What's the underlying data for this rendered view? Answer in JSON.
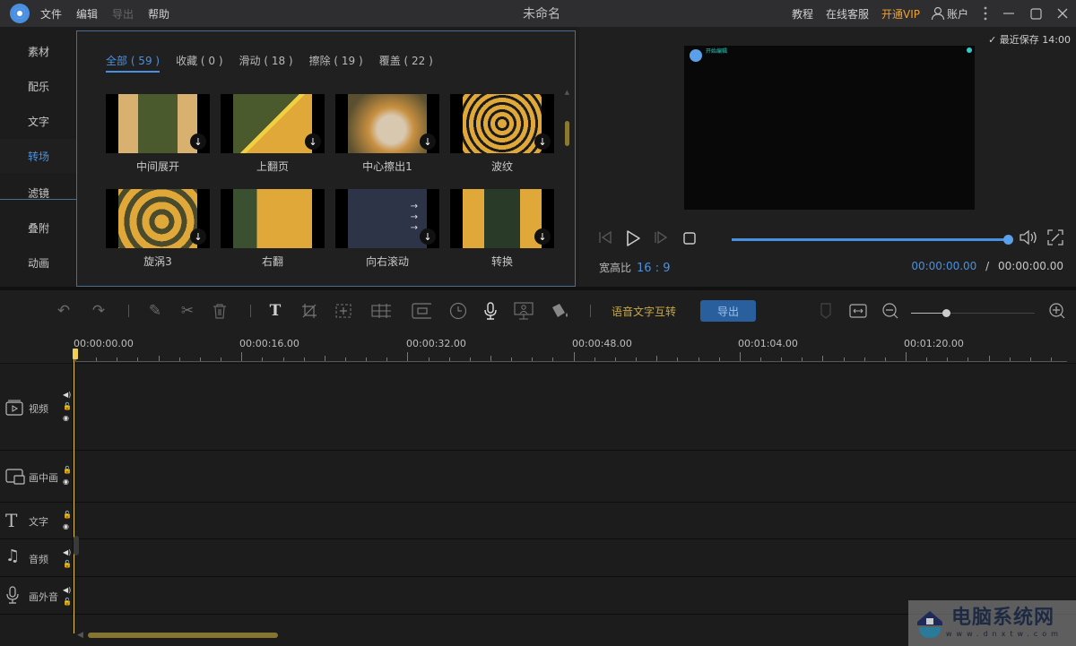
{
  "titlebar": {
    "app_title": "未命名",
    "menu": [
      {
        "label": "文件",
        "enabled": true
      },
      {
        "label": "编辑",
        "enabled": true
      },
      {
        "label": "导出",
        "enabled": false
      },
      {
        "label": "帮助",
        "enabled": true
      }
    ],
    "right": {
      "tutorial": "教程",
      "support": "在线客服",
      "vip": "开通VIP",
      "account": "账户"
    }
  },
  "sidebar": {
    "items": [
      {
        "label": "素材",
        "active": false
      },
      {
        "label": "配乐",
        "active": false
      },
      {
        "label": "文字",
        "active": false
      },
      {
        "label": "转场",
        "active": true
      },
      {
        "label": "滤镜",
        "active": false
      },
      {
        "label": "叠附",
        "active": false
      },
      {
        "label": "动画",
        "active": false
      }
    ]
  },
  "library": {
    "tabs": [
      {
        "label": "全部 ( 59 )",
        "active": true
      },
      {
        "label": "收藏 ( 0 )",
        "active": false
      },
      {
        "label": "滑动 ( 18 )",
        "active": false
      },
      {
        "label": "擦除 ( 19 )",
        "active": false
      },
      {
        "label": "覆盖 ( 22 )",
        "active": false
      }
    ],
    "transitions": [
      {
        "label": "中间展开"
      },
      {
        "label": "上翻页"
      },
      {
        "label": "中心擦出1"
      },
      {
        "label": "波纹"
      },
      {
        "label": "旋涡3"
      },
      {
        "label": "右翻"
      },
      {
        "label": "向右滚动"
      },
      {
        "label": "转换"
      }
    ],
    "download_icon": "↓"
  },
  "preview": {
    "saved": "最近保存 14:00",
    "aspect_label": "宽高比",
    "aspect_value": "16 : 9",
    "current_time": "00:00:00.00",
    "time_sep": "/",
    "total_time": "00:00:00.00",
    "progress": 1.0,
    "screen_caption": "开始编辑"
  },
  "toolbar": {
    "speech_to_text": "语音文字互转",
    "export": "导出",
    "zoom_level": 0.28
  },
  "ruler": {
    "labels": [
      "00:00:00.00",
      "00:00:16.00",
      "00:00:32.00",
      "00:00:48.00",
      "00:01:04.00",
      "00:01:20.00"
    ]
  },
  "tracks": [
    {
      "name": "视频",
      "icon": "video-track-icon"
    },
    {
      "name": "画中画",
      "icon": "pip-track-icon"
    },
    {
      "name": "文字",
      "icon": "text-track-icon"
    },
    {
      "name": "音频",
      "icon": "audio-track-icon"
    },
    {
      "name": "画外音",
      "icon": "voiceover-track-icon"
    }
  ],
  "watermark": {
    "title": "电脑系统网",
    "url": "www.dnxtw.com"
  }
}
